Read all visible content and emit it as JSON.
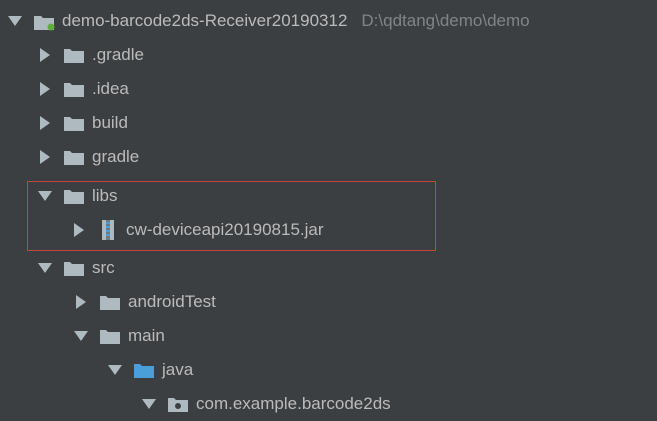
{
  "project_tree": {
    "root": {
      "label": "demo-barcode2ds-Receiver20190312",
      "path": "D:\\qdtang\\demo\\demo"
    },
    "items": [
      {
        "label": ".gradle",
        "expanded": false,
        "icon": "folder-icon"
      },
      {
        "label": ".idea",
        "expanded": false,
        "icon": "folder-icon"
      },
      {
        "label": "build",
        "expanded": false,
        "icon": "folder-icon"
      },
      {
        "label": "gradle",
        "expanded": false,
        "icon": "folder-icon"
      },
      {
        "label": "libs",
        "expanded": true,
        "icon": "folder-icon"
      },
      {
        "label": "cw-deviceapi20190815.jar",
        "expanded": false,
        "icon": "jar-icon"
      },
      {
        "label": "src",
        "expanded": true,
        "icon": "folder-icon"
      },
      {
        "label": "androidTest",
        "expanded": false,
        "icon": "folder-icon"
      },
      {
        "label": "main",
        "expanded": true,
        "icon": "folder-icon"
      },
      {
        "label": "java",
        "expanded": true,
        "icon": "source-folder-icon"
      },
      {
        "label": "com.example.barcode2ds",
        "expanded": true,
        "icon": "package-icon"
      }
    ]
  },
  "colors": {
    "background": "#3c3f41",
    "text": "#bbbbbb",
    "path_text": "#7f8587",
    "folder": "#aeb9c0",
    "source_folder": "#4a9fd8",
    "highlight_border": "#c9423e"
  }
}
